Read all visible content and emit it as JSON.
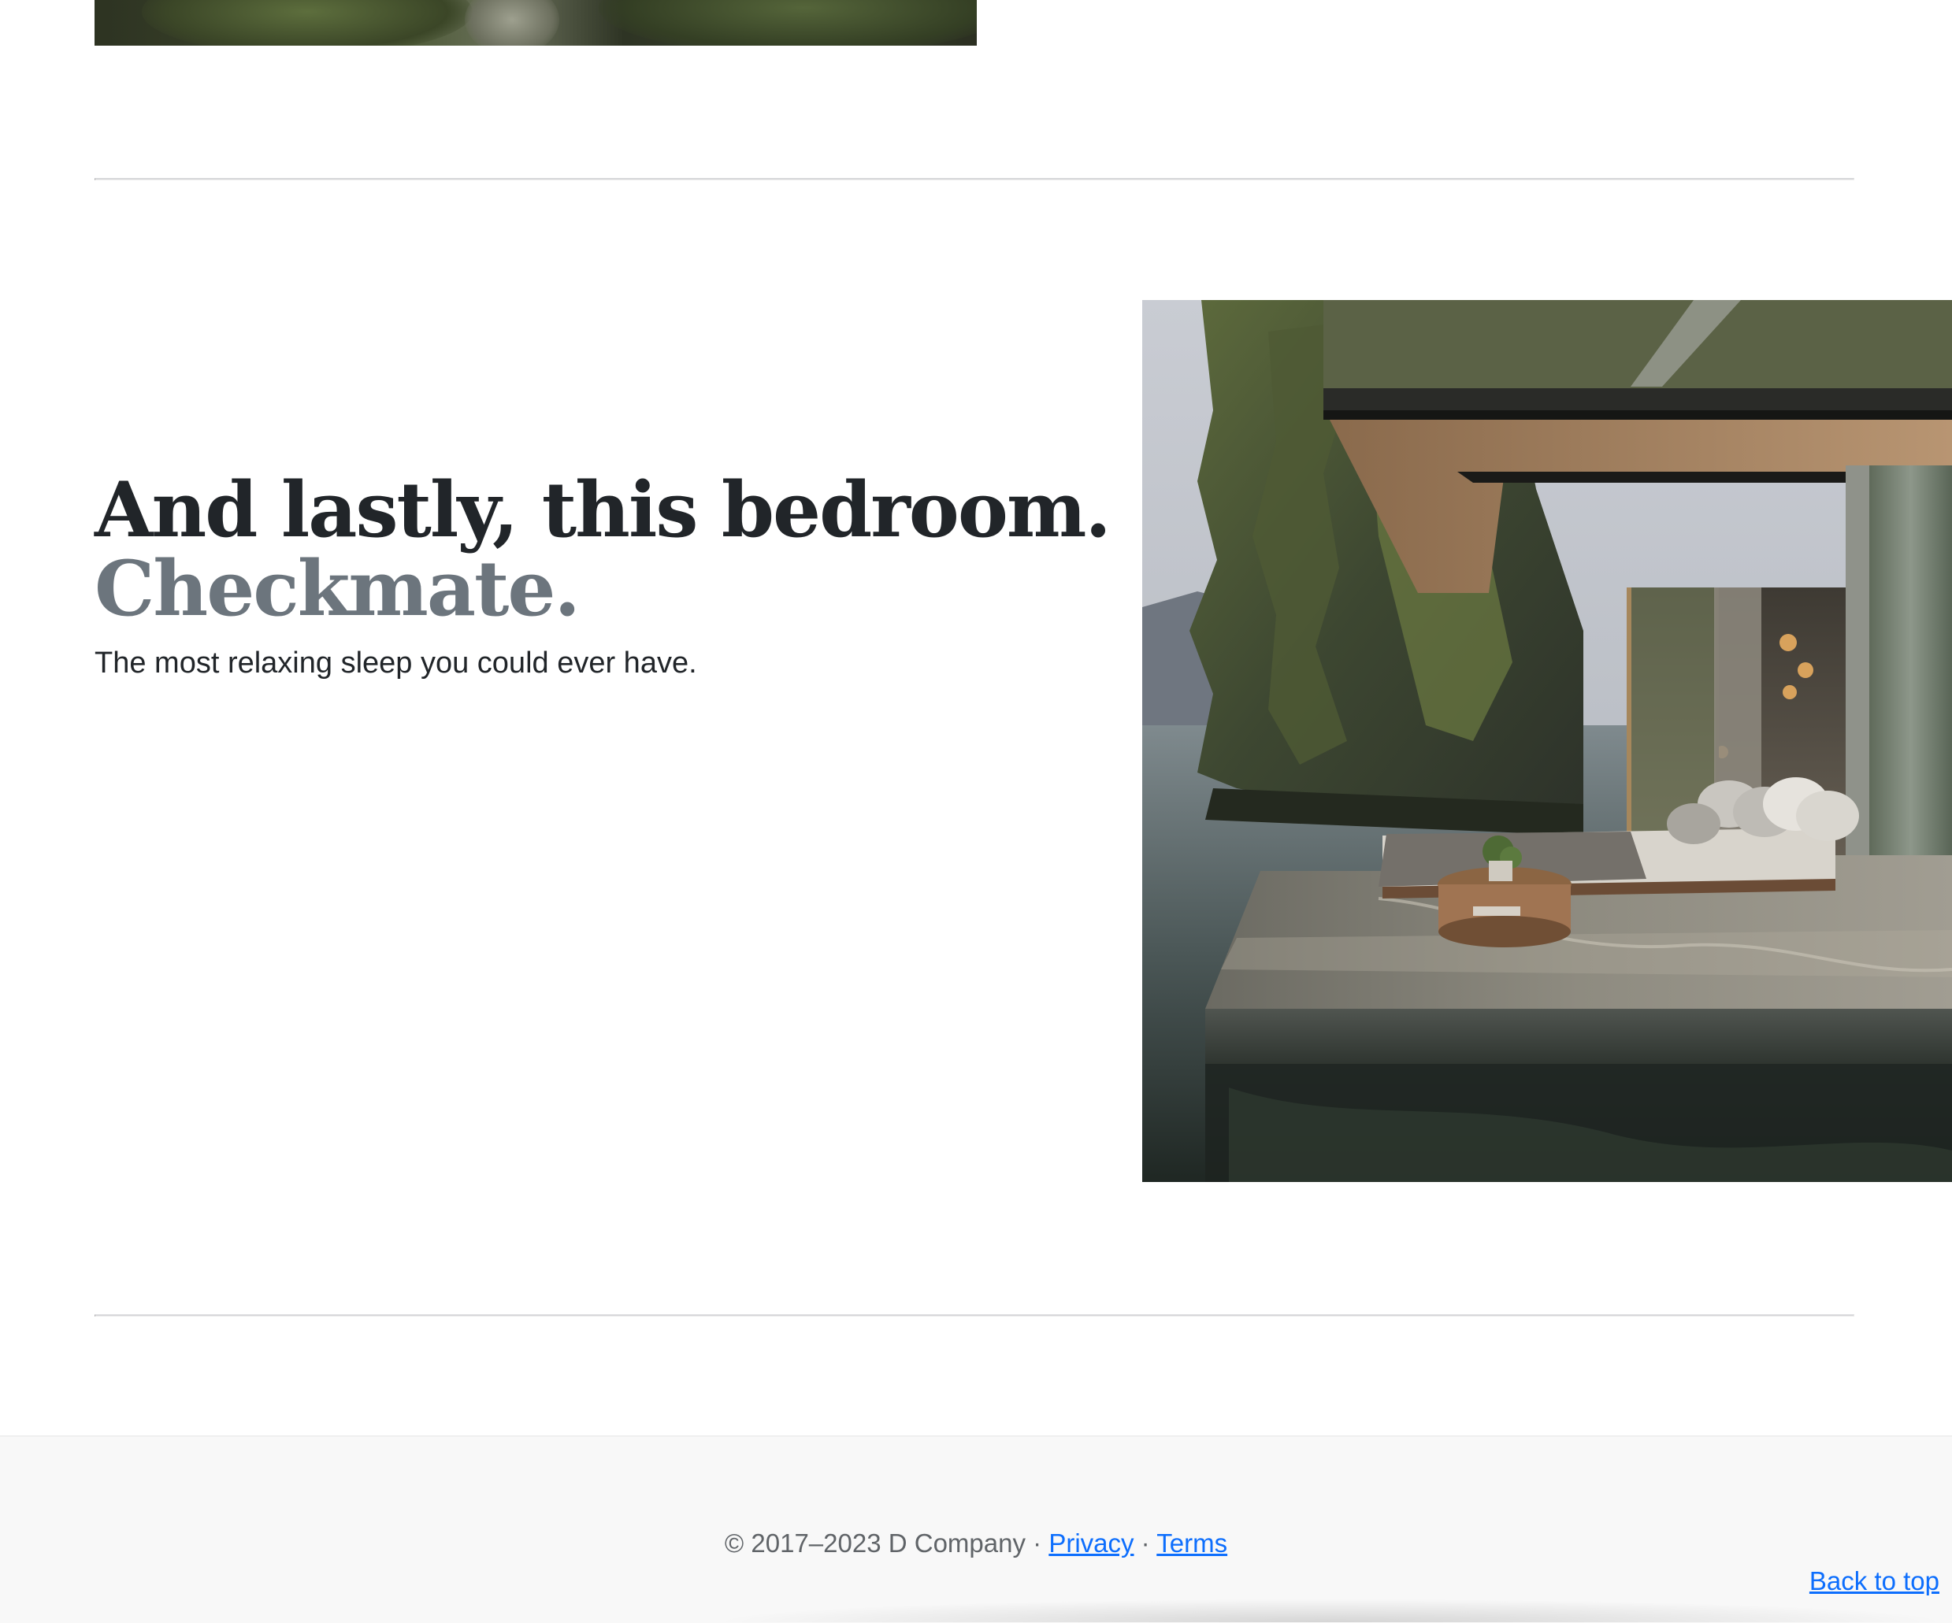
{
  "feature": {
    "heading": "And lastly, this bedroom.",
    "heading_muted": "Checkmate.",
    "lead": "The most relaxing sleep you could ever have."
  },
  "footer": {
    "copyright": "© 2017–2023 D Company",
    "separator": "·",
    "privacy_label": "Privacy",
    "terms_label": "Terms",
    "back_to_top_label": "Back to top"
  },
  "colors": {
    "heading": "#212529",
    "heading_muted": "#6c757d",
    "link": "#0d6efd",
    "footer_bg": "#f8f8f8"
  }
}
